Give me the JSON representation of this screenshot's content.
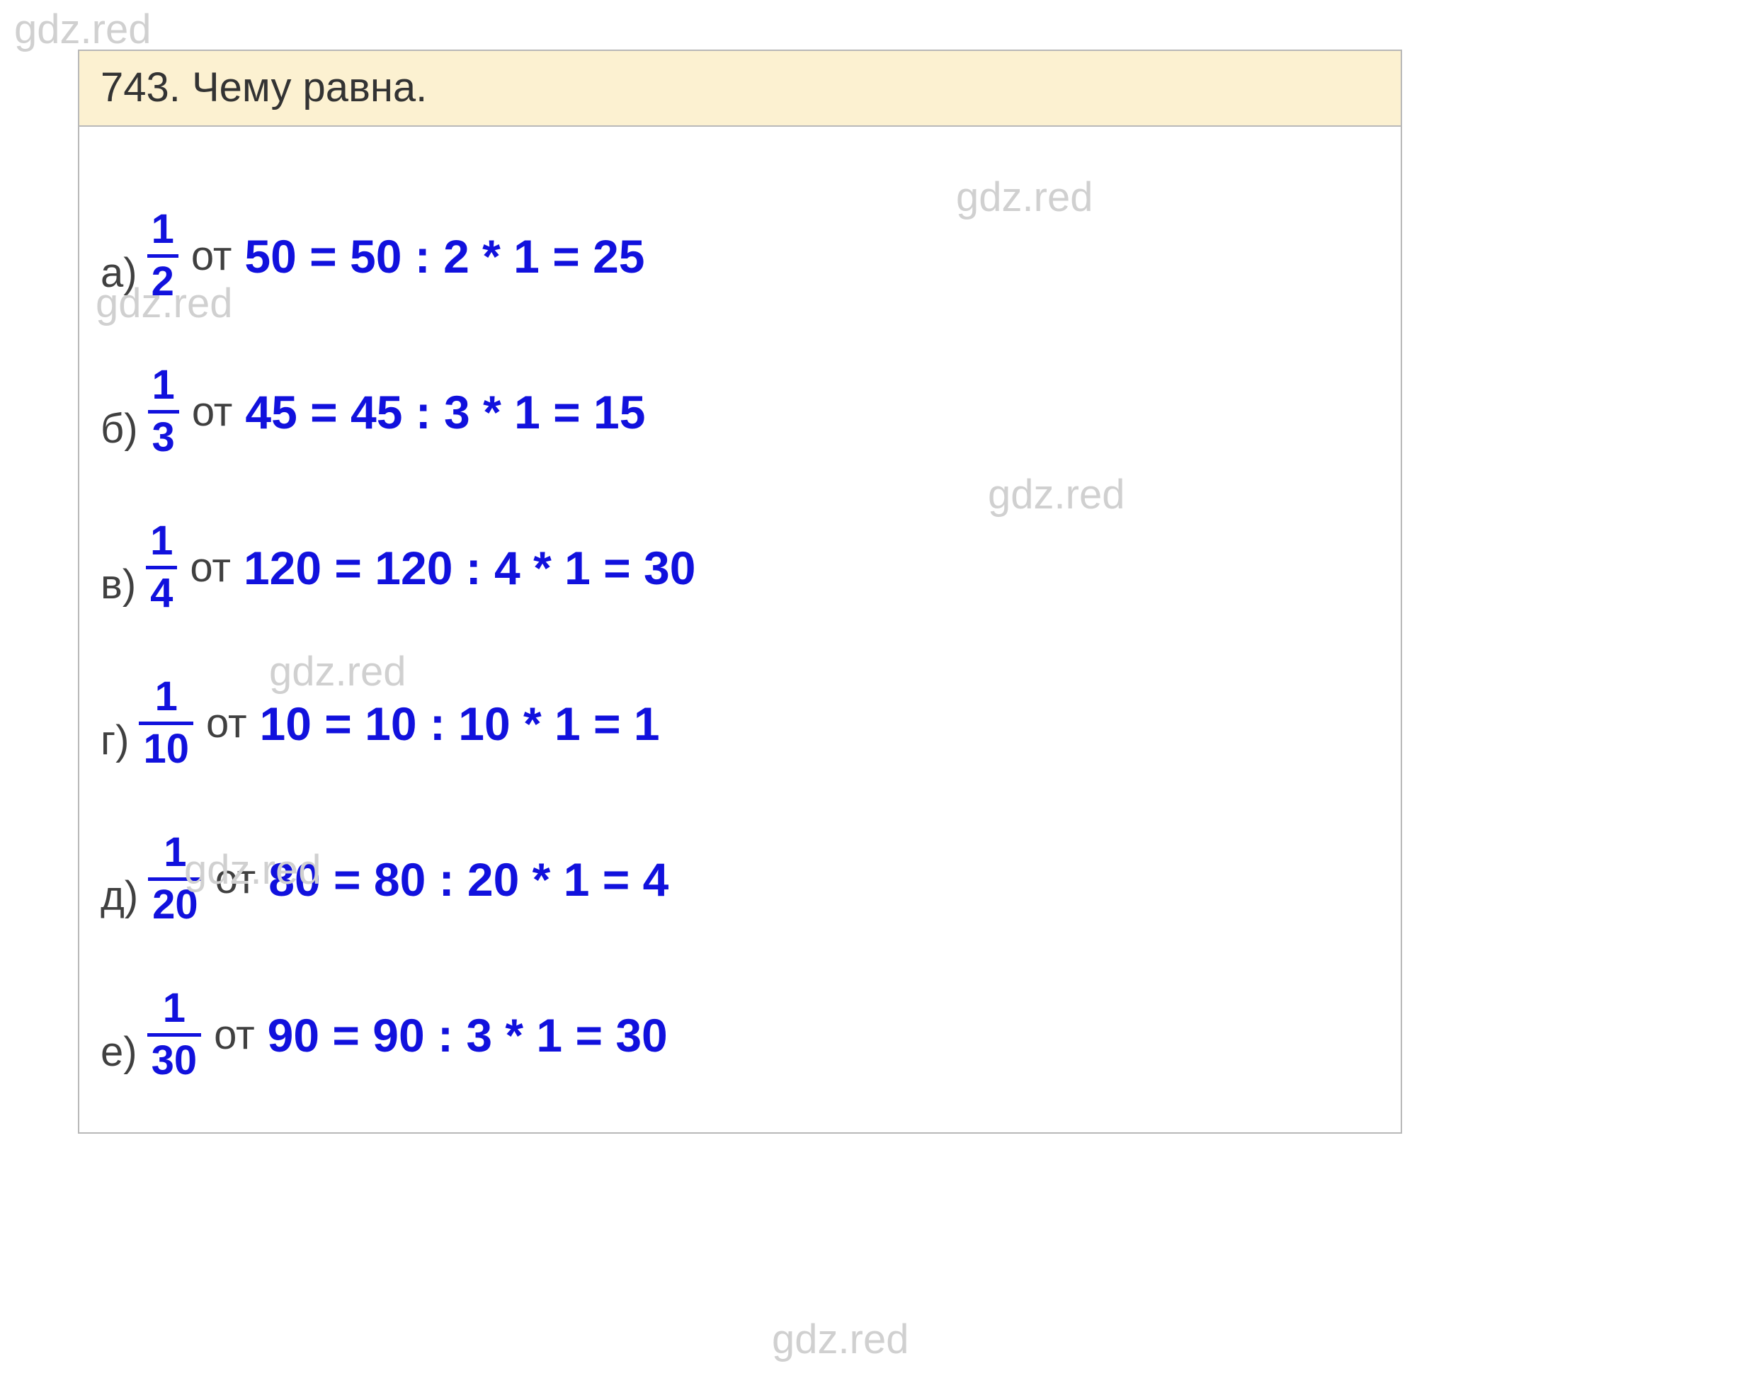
{
  "watermarks": {
    "wm1": "gdz.red",
    "wm2": "gdz.red",
    "wm3": "gdz.red",
    "wm4": "gdz.red",
    "wm5": "gdz.red",
    "wm6": "gdz.red",
    "wm7": "gdz.red"
  },
  "header": {
    "title": "743. Чему равна."
  },
  "rows": {
    "r0": {
      "label": "а)",
      "num": "1",
      "den": "2",
      "ot": "от",
      "expr": "50 = 50 : 2 * 1 = 25"
    },
    "r1": {
      "label": "б)",
      "num": "1",
      "den": "3",
      "ot": "от",
      "expr": "45 = 45 : 3 * 1 = 15"
    },
    "r2": {
      "label": "в)",
      "num": "1",
      "den": "4",
      "ot": "от",
      "expr": "120 = 120 : 4 * 1 = 30"
    },
    "r3": {
      "label": "г)",
      "num": "1",
      "den": "10",
      "ot": "от",
      "expr": "10 = 10 : 10 * 1 = 1"
    },
    "r4": {
      "label": "д)",
      "num": "1",
      "den": "20",
      "ot": "от",
      "expr": "80 = 80 : 20 * 1 = 4"
    },
    "r5": {
      "label": "е)",
      "num": "1",
      "den": "30",
      "ot": "от",
      "expr": "90 = 90 : 3 * 1 = 30"
    }
  }
}
